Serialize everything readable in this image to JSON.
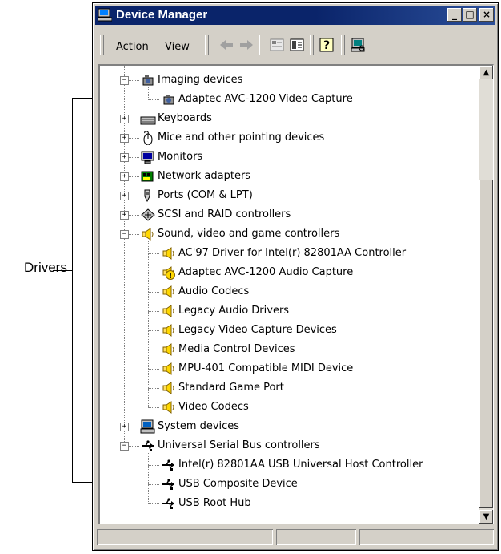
{
  "callout": {
    "label": "Drivers"
  },
  "window": {
    "title": "Device Manager",
    "controls": {
      "minimize": "_",
      "maximize": "□",
      "close": "×"
    }
  },
  "toolbar": {
    "menus": [
      {
        "label": "Action"
      },
      {
        "label": "View"
      }
    ],
    "icons": [
      "back-arrow-icon",
      "forward-arrow-icon",
      "properties-icon",
      "view-icon",
      "help-icon",
      "scan-hardware-icon"
    ]
  },
  "tree": {
    "items": [
      {
        "label": "Imaging devices",
        "level": 0,
        "expander": "−",
        "icon": "camera"
      },
      {
        "label": "Adaptec AVC-1200 Video Capture",
        "level": 1,
        "icon": "camera"
      },
      {
        "label": "Keyboards",
        "level": 0,
        "expander": "+",
        "icon": "keyboard"
      },
      {
        "label": "Mice and other pointing devices",
        "level": 0,
        "expander": "+",
        "icon": "mouse"
      },
      {
        "label": "Monitors",
        "level": 0,
        "expander": "+",
        "icon": "monitor"
      },
      {
        "label": "Network adapters",
        "level": 0,
        "expander": "+",
        "icon": "network"
      },
      {
        "label": "Ports (COM & LPT)",
        "level": 0,
        "expander": "+",
        "icon": "port"
      },
      {
        "label": "SCSI and RAID controllers",
        "level": 0,
        "expander": "+",
        "icon": "scsi"
      },
      {
        "label": "Sound, video and game controllers",
        "level": 0,
        "expander": "−",
        "icon": "speaker"
      },
      {
        "label": "AC'97 Driver for Intel(r) 82801AA Controller",
        "level": 1,
        "icon": "speaker"
      },
      {
        "label": "Adaptec AVC-1200 Audio Capture",
        "level": 1,
        "icon": "speaker-warning"
      },
      {
        "label": "Audio Codecs",
        "level": 1,
        "icon": "speaker"
      },
      {
        "label": "Legacy Audio Drivers",
        "level": 1,
        "icon": "speaker"
      },
      {
        "label": "Legacy Video Capture Devices",
        "level": 1,
        "icon": "speaker"
      },
      {
        "label": "Media Control Devices",
        "level": 1,
        "icon": "speaker"
      },
      {
        "label": "MPU-401 Compatible MIDI Device",
        "level": 1,
        "icon": "speaker"
      },
      {
        "label": "Standard Game Port",
        "level": 1,
        "icon": "speaker"
      },
      {
        "label": "Video Codecs",
        "level": 1,
        "icon": "speaker"
      },
      {
        "label": "System devices",
        "level": 0,
        "expander": "+",
        "icon": "computer"
      },
      {
        "label": "Universal Serial Bus controllers",
        "level": 0,
        "expander": "−",
        "icon": "usb"
      },
      {
        "label": "Intel(r) 82801AA USB Universal Host Controller",
        "level": 1,
        "icon": "usb"
      },
      {
        "label": "USB Composite Device",
        "level": 1,
        "icon": "usb"
      },
      {
        "label": "USB Root Hub",
        "level": 1,
        "icon": "usb"
      }
    ]
  },
  "colors": {
    "titlebar": "#0a246a",
    "window": "#d4d0c8",
    "warning": "#ffd800"
  }
}
